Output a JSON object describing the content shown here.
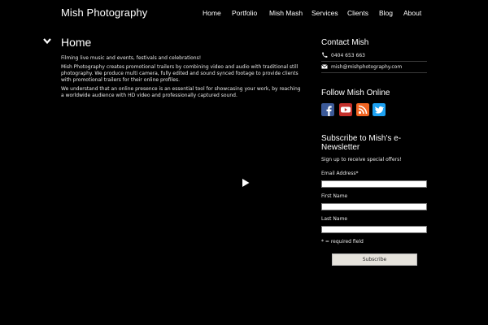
{
  "header": {
    "site_title": "Mish Photography",
    "nav": [
      "Home",
      "Portfolio",
      "Mish Mash",
      "Services",
      "Clients",
      "Blog",
      "About"
    ]
  },
  "main": {
    "title": "Home",
    "paragraphs": [
      "Filming live music and events, festivals and celebrations!",
      "Mish Photography creates promotional trailers by combining video and audio with traditional still photography. We produce multi camera, fully edited and sound synced footage to provide clients with promotional trailers for their online profiles.",
      "We understand that an online presence is an essential tool for showcasing your work, by reaching a worldwide audience with HD video and professionally captured sound."
    ],
    "video": {
      "icon": "play-icon"
    }
  },
  "sidebar": {
    "contact": {
      "heading": "Contact Mish",
      "phone": "0404 653 663",
      "email": "mish@mishphotography.com"
    },
    "follow": {
      "heading": "Follow Mish Online",
      "icons": [
        "facebook-icon",
        "youtube-icon",
        "rss-icon",
        "twitter-icon"
      ]
    },
    "newsletter": {
      "heading": "Subscribe to Mish's e-Newsletter",
      "note": "Sign up to receive special offers!",
      "fields": [
        "Email Address*",
        "First Name",
        "Last Name"
      ],
      "required_note": "* = required field",
      "button": "Subscribe"
    }
  },
  "colors": {
    "background": "#000000",
    "text": "#ffffff",
    "facebook": "#3b5998",
    "youtube": "#c4302b",
    "rss": "#f26522",
    "twitter": "#1da1f2",
    "button_bg": "#e6e3dc"
  }
}
